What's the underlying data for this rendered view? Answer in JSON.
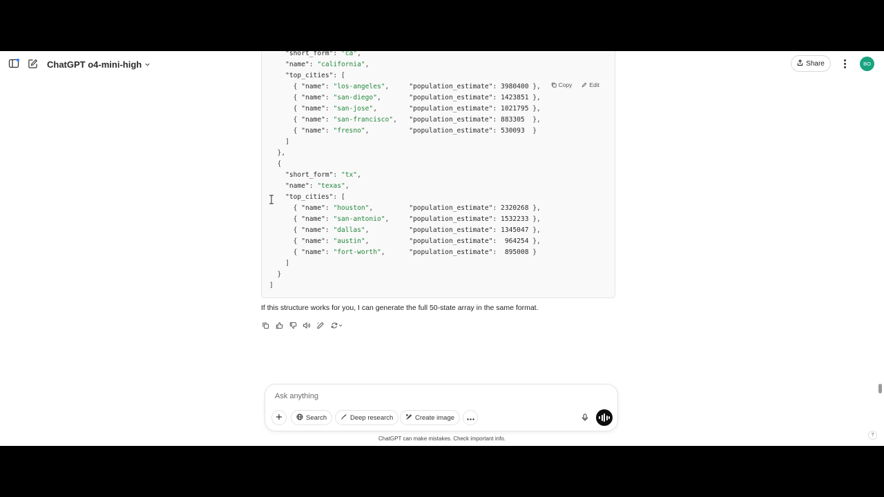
{
  "header": {
    "model_name": "ChatGPT o4-mini-high",
    "share_label": "Share",
    "avatar_initials": "BO"
  },
  "code_block": {
    "copy_label": "Copy",
    "edit_label": "Edit",
    "lines": [
      [
        {
          "t": "    "
        },
        {
          "c": "k",
          "t": "\"short_form\""
        },
        {
          "t": ": "
        },
        {
          "c": "s",
          "t": "\"ca\""
        },
        {
          "t": ","
        }
      ],
      [
        {
          "t": "    "
        },
        {
          "c": "k",
          "t": "\"name\""
        },
        {
          "t": ": "
        },
        {
          "c": "s",
          "t": "\"california\""
        },
        {
          "t": ","
        }
      ],
      [
        {
          "t": "    "
        },
        {
          "c": "k",
          "t": "\"top_cities\""
        },
        {
          "t": ": ["
        }
      ],
      [
        {
          "t": "      { "
        },
        {
          "c": "k",
          "t": "\"name\""
        },
        {
          "t": ": "
        },
        {
          "c": "s",
          "t": "\"los-angeles\""
        },
        {
          "t": ",     "
        },
        {
          "c": "k",
          "t": "\"population_estimate\""
        },
        {
          "t": ": "
        },
        {
          "c": "n",
          "t": "3980400"
        },
        {
          "t": " },"
        }
      ],
      [
        {
          "t": "      { "
        },
        {
          "c": "k",
          "t": "\"name\""
        },
        {
          "t": ": "
        },
        {
          "c": "s",
          "t": "\"san-diego\""
        },
        {
          "t": ",       "
        },
        {
          "c": "k",
          "t": "\"population_estimate\""
        },
        {
          "t": ": "
        },
        {
          "c": "n",
          "t": "1423851"
        },
        {
          "t": " },"
        }
      ],
      [
        {
          "t": "      { "
        },
        {
          "c": "k",
          "t": "\"name\""
        },
        {
          "t": ": "
        },
        {
          "c": "s",
          "t": "\"san-jose\""
        },
        {
          "t": ",        "
        },
        {
          "c": "k",
          "t": "\"population_estimate\""
        },
        {
          "t": ": "
        },
        {
          "c": "n",
          "t": "1021795"
        },
        {
          "t": " },"
        }
      ],
      [
        {
          "t": "      { "
        },
        {
          "c": "k",
          "t": "\"name\""
        },
        {
          "t": ": "
        },
        {
          "c": "s",
          "t": "\"san-francisco\""
        },
        {
          "t": ",   "
        },
        {
          "c": "k",
          "t": "\"population_estimate\""
        },
        {
          "t": ": "
        },
        {
          "c": "n",
          "t": "883305"
        },
        {
          "t": "  },"
        }
      ],
      [
        {
          "t": "      { "
        },
        {
          "c": "k",
          "t": "\"name\""
        },
        {
          "t": ": "
        },
        {
          "c": "s",
          "t": "\"fresno\""
        },
        {
          "t": ",          "
        },
        {
          "c": "k",
          "t": "\"population_estimate\""
        },
        {
          "t": ": "
        },
        {
          "c": "n",
          "t": "530093"
        },
        {
          "t": "  }"
        }
      ],
      [
        {
          "t": "    ]"
        }
      ],
      [
        {
          "t": "  },"
        }
      ],
      [
        {
          "t": "  {"
        }
      ],
      [
        {
          "t": "    "
        },
        {
          "c": "k",
          "t": "\"short_form\""
        },
        {
          "t": ": "
        },
        {
          "c": "s",
          "t": "\"tx\""
        },
        {
          "t": ","
        }
      ],
      [
        {
          "t": "    "
        },
        {
          "c": "k",
          "t": "\"name\""
        },
        {
          "t": ": "
        },
        {
          "c": "s",
          "t": "\"texas\""
        },
        {
          "t": ","
        }
      ],
      [
        {
          "t": "    "
        },
        {
          "c": "k",
          "t": "\"top_cities\""
        },
        {
          "t": ": ["
        }
      ],
      [
        {
          "t": "      { "
        },
        {
          "c": "k",
          "t": "\"name\""
        },
        {
          "t": ": "
        },
        {
          "c": "s",
          "t": "\"houston\""
        },
        {
          "t": ",         "
        },
        {
          "c": "k",
          "t": "\"population_estimate\""
        },
        {
          "t": ": "
        },
        {
          "c": "n",
          "t": "2320268"
        },
        {
          "t": " },"
        }
      ],
      [
        {
          "t": "      { "
        },
        {
          "c": "k",
          "t": "\"name\""
        },
        {
          "t": ": "
        },
        {
          "c": "s",
          "t": "\"san-antonio\""
        },
        {
          "t": ",     "
        },
        {
          "c": "k",
          "t": "\"population_estimate\""
        },
        {
          "t": ": "
        },
        {
          "c": "n",
          "t": "1532233"
        },
        {
          "t": " },"
        }
      ],
      [
        {
          "t": "      { "
        },
        {
          "c": "k",
          "t": "\"name\""
        },
        {
          "t": ": "
        },
        {
          "c": "s",
          "t": "\"dallas\""
        },
        {
          "t": ",          "
        },
        {
          "c": "k",
          "t": "\"population_estimate\""
        },
        {
          "t": ": "
        },
        {
          "c": "n",
          "t": "1345047"
        },
        {
          "t": " },"
        }
      ],
      [
        {
          "t": "      { "
        },
        {
          "c": "k",
          "t": "\"name\""
        },
        {
          "t": ": "
        },
        {
          "c": "s",
          "t": "\"austin\""
        },
        {
          "t": ",          "
        },
        {
          "c": "k",
          "t": "\"population_estimate\""
        },
        {
          "t": ":  "
        },
        {
          "c": "n",
          "t": "964254"
        },
        {
          "t": " },"
        }
      ],
      [
        {
          "t": "      { "
        },
        {
          "c": "k",
          "t": "\"name\""
        },
        {
          "t": ": "
        },
        {
          "c": "s",
          "t": "\"fort-worth\""
        },
        {
          "t": ",      "
        },
        {
          "c": "k",
          "t": "\"population_estimate\""
        },
        {
          "t": ":  "
        },
        {
          "c": "n",
          "t": "895008"
        },
        {
          "t": " }"
        }
      ],
      [
        {
          "t": "    ]"
        }
      ],
      [
        {
          "t": "  }"
        }
      ],
      [
        {
          "t": "]"
        }
      ]
    ]
  },
  "assistant_message": "If this structure works for you, I can generate the full 50-state array in the same format.",
  "composer": {
    "placeholder": "Ask anything",
    "search_label": "Search",
    "deep_research_label": "Deep research",
    "create_image_label": "Create image"
  },
  "disclaimer": "ChatGPT can make mistakes. Check important info.",
  "help_label": "?",
  "colors": {
    "accent": "#19a37f",
    "string": "#22863a"
  }
}
